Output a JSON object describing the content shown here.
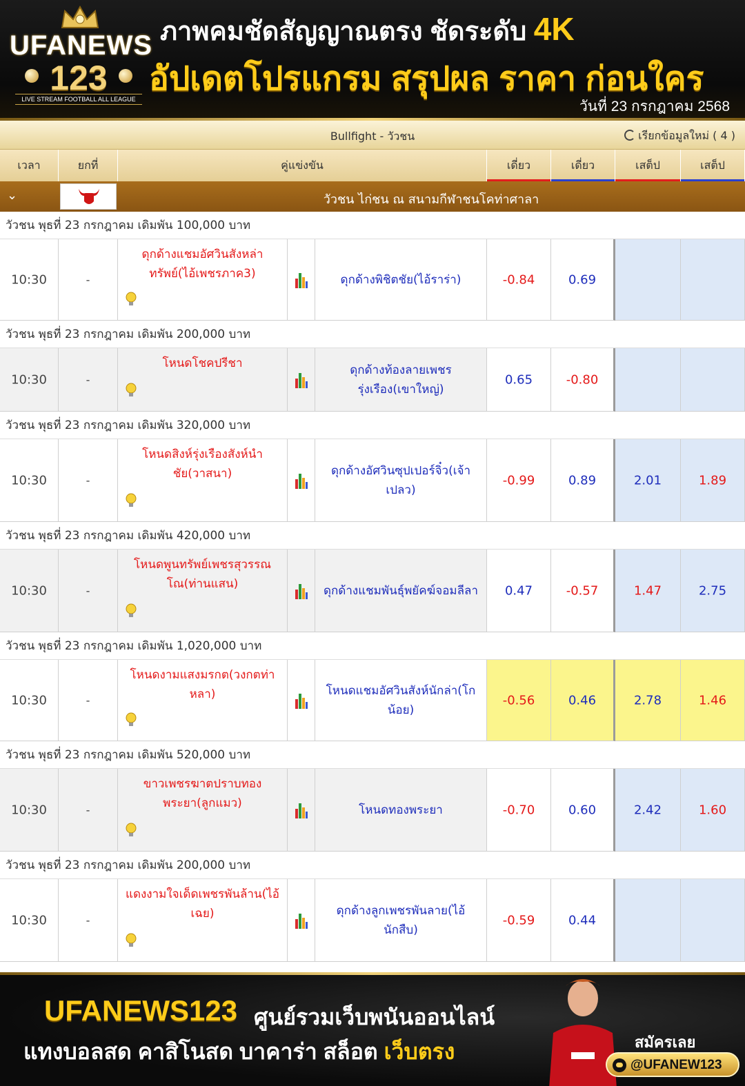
{
  "header": {
    "logo_brand": "UFANEWS",
    "logo_number": "123",
    "logo_tagline": "LIVE STREAM FOOTBALL ALL LEAGUE",
    "headline_main": "ภาพคมชัดสัญญาณตรง ชัดระดับ",
    "headline_4k": "4K",
    "headline_sub": "อัปเดตโปรแกรม สรุปผล ราคา ก่อนใคร",
    "date": "วันที่ 23 กรกฎาคม 2568"
  },
  "title_bar": {
    "title": "Bullfight - วัวชน",
    "refresh": "เรียกข้อมูลใหม่ ( 4 )"
  },
  "columns": {
    "time": "เวลา",
    "round": "ยกที่",
    "match": "คู่แข่งขัน",
    "odds1": "เดี่ยว",
    "odds2": "เดี่ยว",
    "set1": "เสต็ป",
    "set2": "เสต็ป"
  },
  "league": {
    "name": "วัวชน ไก่ชน ณ สนามกีฬาชนโคท่าศาลา"
  },
  "matches": [
    {
      "label": "วัวชน พุธที่ 23 กรกฎาคม เดิมพัน 100,000 บาท",
      "time": "10:30",
      "round": "-",
      "home": "ดุกด้างแชมอัศวินสังหล่าทรัพย์(ไอ้เพชรภาค3)",
      "away": "ดุกด้างพิชิตชัย(ไอ้ราร่า)",
      "o1": "-0.84",
      "o2": "0.69",
      "s1": "",
      "s2": ""
    },
    {
      "label": "วัวชน พุธที่ 23 กรกฎาคม เดิมพัน 200,000 บาท",
      "time": "10:30",
      "round": "-",
      "home": "โหนดโชคปรีชา",
      "away": "ดุกด้างท้องลายเพชรรุ่งเรือง(เขาใหญ่)",
      "o1": "0.65",
      "o2": "-0.80",
      "s1": "",
      "s2": ""
    },
    {
      "label": "วัวชน พุธที่ 23 กรกฎาคม เดิมพัน 320,000 บาท",
      "time": "10:30",
      "round": "-",
      "home": "โหนดสิงห์รุ่งเรืองสังห์นำชัย(วาสนา)",
      "away": "ดุกด้างอัศวินซุปเปอร์จิ๋ว(เจ้าเปลว)",
      "o1": "-0.99",
      "o2": "0.89",
      "s1": "2.01",
      "s2": "1.89"
    },
    {
      "label": "วัวชน พุธที่ 23 กรกฎาคม เดิมพัน 420,000 บาท",
      "time": "10:30",
      "round": "-",
      "home": "โหนดพูนทรัพย์เพชรสุวรรณโณ(ท่านแสน)",
      "away": "ดุกด้างแชมพันธุ์พยัคฆ์จอมลีลา",
      "o1": "0.47",
      "o2": "-0.57",
      "s1": "1.47",
      "s2": "2.75"
    },
    {
      "label": "วัวชน พุธที่ 23 กรกฎาคม เดิมพัน 1,020,000 บาท",
      "time": "10:30",
      "round": "-",
      "home": "โหนดงามแสงมรกต(วงกตท่าหลา)",
      "away": "โหนดแชมอัศวินสังห์นักล่า(โกน้อย)",
      "o1": "-0.56",
      "o2": "0.46",
      "s1": "2.78",
      "s2": "1.46"
    },
    {
      "label": "วัวชน พุธที่ 23 กรกฎาคม เดิมพัน 520,000 บาท",
      "time": "10:30",
      "round": "-",
      "home": "ขาวเพชรฆาตปราบทองพระยา(ลูกแมว)",
      "away": "โหนดทองพระยา",
      "o1": "-0.70",
      "o2": "0.60",
      "s1": "2.42",
      "s2": "1.60"
    },
    {
      "label": "วัวชน พุธที่ 23 กรกฎาคม เดิมพัน 200,000 บาท",
      "time": "10:30",
      "round": "-",
      "home": "แดงงามใจเด็ดเพชรพันล้าน(ไอ้เฉย)",
      "away": "ดุกด้างลูกเพชรพันลาย(ไอ้นักสืบ)",
      "o1": "-0.59",
      "o2": "0.44",
      "s1": "",
      "s2": ""
    }
  ],
  "footer": {
    "brand": "UFANEWS123",
    "line1": "ศูนย์รวมเว็บพนันออนไลน์",
    "line2": "แทงบอลสด คาสิโนสด บาคาร่า สล็อต",
    "line2_gold": "เว็บตรง",
    "signup": "สมัครเลย",
    "line_id": "@UFANEW123"
  },
  "colors": {
    "negative": "#e41919",
    "positive": "#1e2dbb",
    "highlight": "#fbf58c",
    "set_bg": "#dde8f7"
  }
}
